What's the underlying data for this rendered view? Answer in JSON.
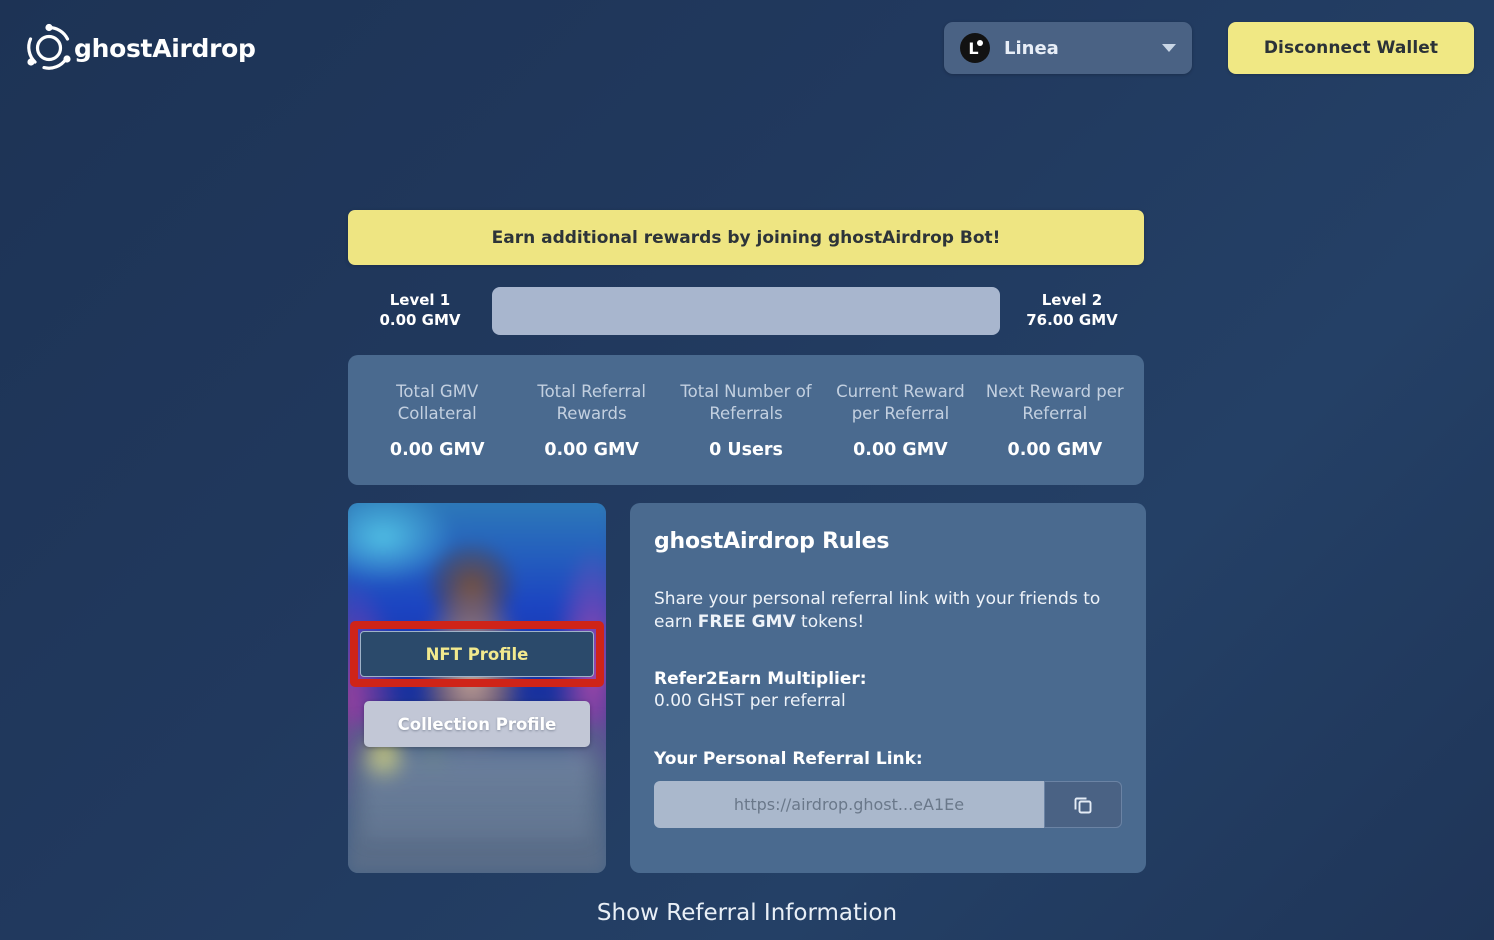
{
  "header": {
    "brand_name": "ghostAirdrop",
    "brand_logo_icon": "ghost-ring-logo-icon",
    "chain_selector": {
      "name": "Linea",
      "logo_icon": "linea-logo-icon",
      "caret_icon": "chevron-down-icon"
    },
    "disconnect_label": "Disconnect Wallet"
  },
  "promo": {
    "banner_text": "Earn additional rewards by joining ghostAirdrop Bot!"
  },
  "level": {
    "left_title": "Level 1",
    "left_amount": "0.00 GMV",
    "right_title": "Level 2",
    "right_amount": "76.00 GMV",
    "progress_percent": 0
  },
  "stats": [
    {
      "label": "Total GMV Collateral",
      "value": "0.00 GMV"
    },
    {
      "label": "Total Referral Rewards",
      "value": "0.00 GMV"
    },
    {
      "label": "Total Number of Referrals",
      "value": "0 Users"
    },
    {
      "label": "Current Reward per Referral",
      "value": "0.00 GMV"
    },
    {
      "label": "Next Reward per Referral",
      "value": "0.00 GMV"
    }
  ],
  "nft_card": {
    "nft_profile_label": "NFT Profile",
    "collection_profile_label": "Collection Profile",
    "highlight_color": "#cf2418",
    "nft_profile_text_color": "#f2e98e"
  },
  "rules": {
    "title": "ghostAirdrop Rules",
    "body_prefix": "Share your personal referral link with your friends to earn ",
    "body_bold": "FREE GMV",
    "body_suffix": " tokens!",
    "multiplier_title": "Refer2Earn Multiplier:",
    "multiplier_value": "0.00 GHST per referral",
    "referral_link_title": "Your Personal Referral Link:",
    "referral_link_value": "https://airdrop.ghost...eA1Ee",
    "copy_icon": "copy-icon"
  },
  "footer": {
    "show_referral_label": "Show Referral Information"
  },
  "colors": {
    "background": "#21395e",
    "accent_yellow": "#eee582",
    "panel": "#4a6a8f",
    "progress_track": "#a8b6ce",
    "highlight_red": "#cf2418"
  }
}
